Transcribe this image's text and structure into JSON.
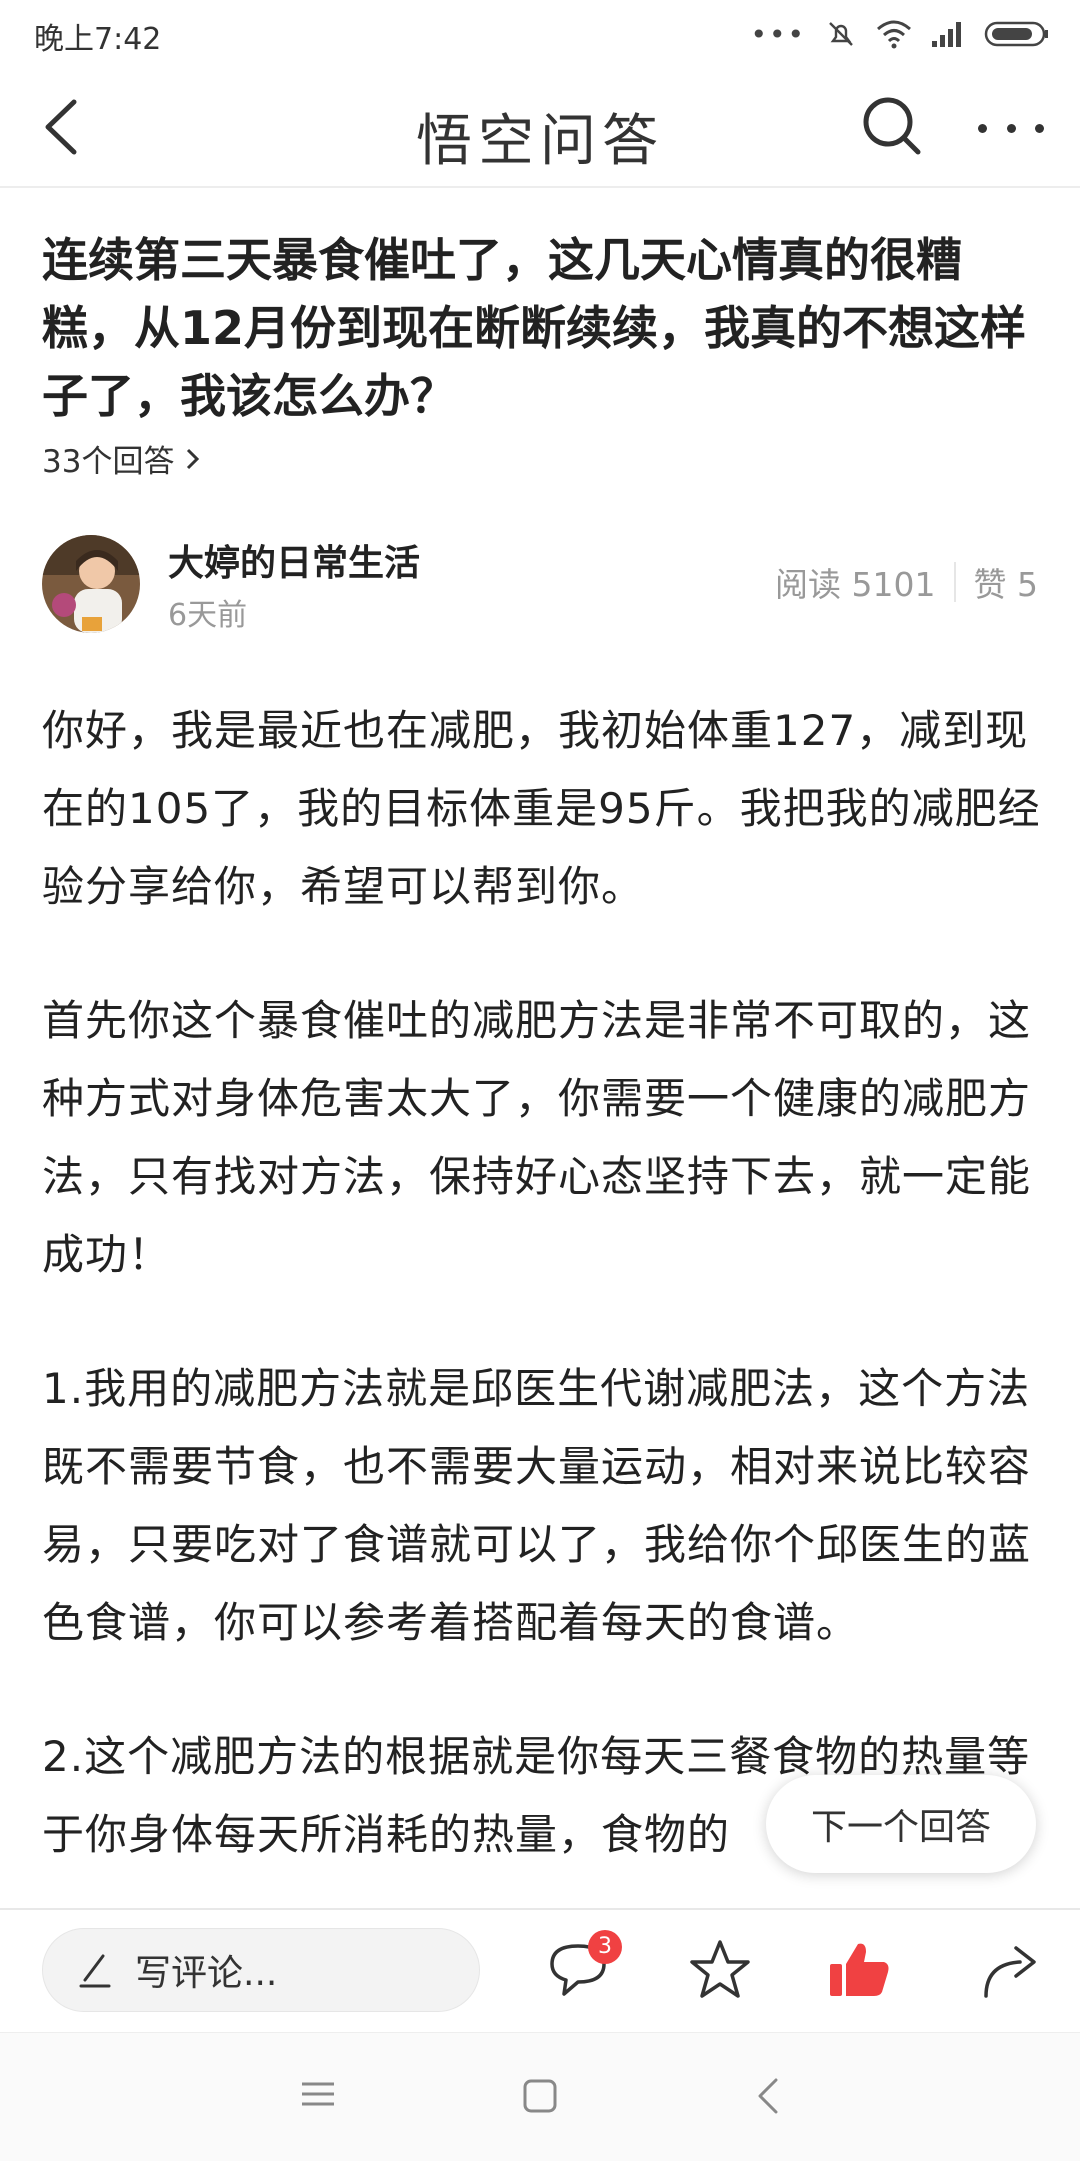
{
  "status_bar": {
    "time": "晚上7:42"
  },
  "header": {
    "title": "悟空问答"
  },
  "question": {
    "title": "连续第三天暴食催吐了，这几天心情真的很糟糕，从12月份到现在断断续续，我真的不想这样子了，我该怎么办？",
    "answer_count": "33个回答"
  },
  "author": {
    "name": "大婷的日常生活",
    "time": "6天前",
    "reads": "阅读 5101",
    "likes": "赞 5"
  },
  "article": {
    "p1": "你好，我是最近也在减肥，我初始体重127，减到现在的105了，我的目标体重是95斤。我把我的减肥经验分享给你，希望可以帮到你。",
    "p2": "首先你这个暴食催吐的减肥方法是非常不可取的，这种方式对身体危害太大了，你需要一个健康的减肥方法，只有找对方法，保持好心态坚持下去，就一定能成功！",
    "p3": "1.我用的减肥方法就是邱医生代谢减肥法，这个方法既不需要节食，也不需要大量运动，相对来说比较容易，只要吃对了食谱就可以了，我给你个邱医生的蓝色食谱，你可以参考着搭配着每天的食谱。",
    "p4": "2.这个减肥方法的根据就是你每天三餐食物的热量等于你身体每天所消耗的热量，食物的"
  },
  "next_answer_label": "下一个回答",
  "action_bar": {
    "comment_placeholder": "写评论...",
    "comment_badge": "3"
  },
  "colors": {
    "accent_red": "#f04142"
  },
  "icons": [
    "back-icon",
    "search-icon",
    "more-icon",
    "chevron-right-icon",
    "pen-icon",
    "comment-icon",
    "star-icon",
    "thumbs-up-icon",
    "share-icon",
    "menu-icon",
    "home-icon",
    "back-nav-icon"
  ]
}
